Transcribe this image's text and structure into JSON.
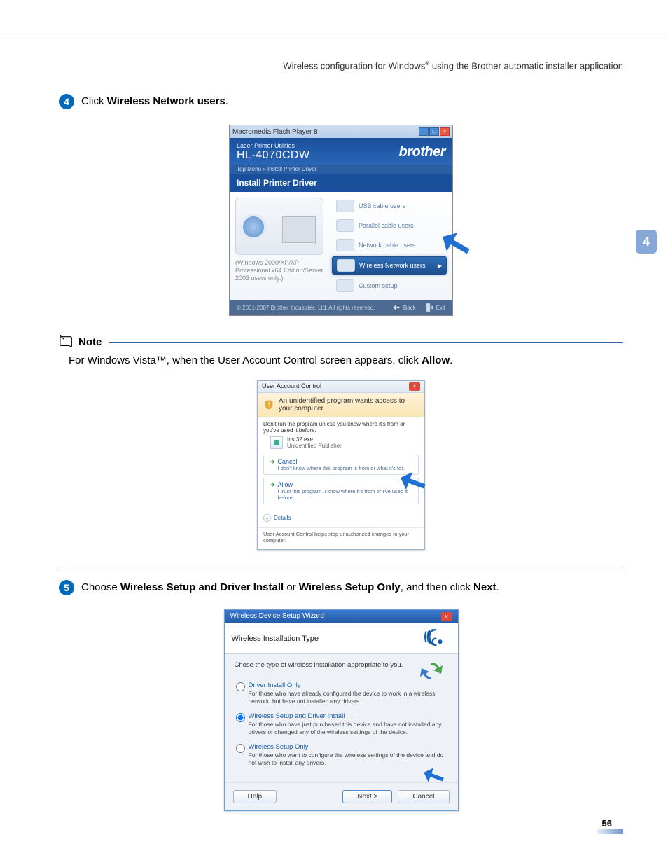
{
  "header": {
    "text_pre": "Wireless configuration for Windows",
    "text_post": " using the Brother automatic installer application"
  },
  "chapter_tab": "4",
  "step4": {
    "num": "4",
    "text_pre": "Click ",
    "link": "Wireless Network users",
    "text_post": "."
  },
  "ss1": {
    "titlebar": "Macromedia Flash Player 8",
    "header_sub": "Laser Printer Utilities",
    "header_model": "HL-4070CDW",
    "brand": "brother",
    "crumb": "Top Menu  »  Install Printer Driver",
    "section": "Install Printer Driver",
    "left_note": "(Windows 2000/XP/XP Professional x64 Edition/Server 2003 users only.)",
    "opts": [
      "USB cable users",
      "Parallel cable users",
      "Network cable users",
      "Wireless Network users",
      "Custom setup"
    ],
    "footer_copy": "© 2001-2007 Brother Industries, Ltd. All rights reserved.",
    "back": "Back",
    "exit": "Exit"
  },
  "note": {
    "label": "Note",
    "body_pre": "For Windows Vista™, when the User Account Control screen appears, click ",
    "bold": "Allow",
    "body_post": "."
  },
  "ss2": {
    "title": "User Account Control",
    "main": "An unidentified program wants access to your computer",
    "sec": "Don't run the program unless you know where it's from or you've used it before.",
    "prog_name": "Inst32.exe",
    "prog_pub": "Unidentified Publisher",
    "cancel_h": "Cancel",
    "cancel_d": "I don't know where this program is from or what it's for.",
    "allow_h": "Allow",
    "allow_d": "I trust this program. I know where it's from or I've used it before.",
    "details": "Details",
    "foot": "User Account Control helps stop unauthorized changes to your computer."
  },
  "step5": {
    "num": "5",
    "text_pre": "Choose ",
    "b1": "Wireless Setup and Driver Install",
    "mid": " or ",
    "b2": "Wireless Setup Only",
    "text_post": ", and then click ",
    "b3": "Next",
    "end": "."
  },
  "ss3": {
    "title": "Wireless Device Setup Wizard",
    "head": "Wireless Installation Type",
    "intro": "Chose the type of wireless installation appropriate to you.",
    "opt1_h": "Driver Install Only",
    "opt1_d": "For those who have already configured the device to work in a wireless network, but have not installed any drivers.",
    "opt2_h": "Wireless Setup and Driver Install",
    "opt2_d": "For those who have just purchased this device and have not installed any drivers or changed any of the wireless settings of the device.",
    "opt3_h": "Wireless Setup Only",
    "opt3_d": "For those who want to configure the wireless settings of the device and do not wish to install any drivers.",
    "help": "Help",
    "next": "Next >",
    "cancel": "Cancel"
  },
  "page_number": "56"
}
